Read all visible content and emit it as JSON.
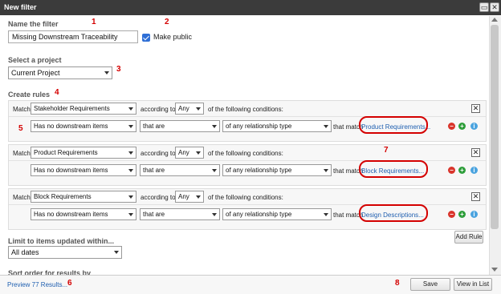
{
  "window": {
    "title": "New filter"
  },
  "filter_name": {
    "label": "Name the filter",
    "value": "Missing Downstream Traceability",
    "make_public_label": "Make public",
    "make_public": true
  },
  "project": {
    "label": "Select a project",
    "value": "Current Project"
  },
  "rules": {
    "label": "Create rules",
    "items": [
      {
        "match": "Match",
        "type": "Stakeholder Requirements",
        "according": "according to",
        "mode": "Any",
        "following": "of the following conditions:",
        "condition": "Has no downstream items",
        "qualifier": "that are",
        "relationship": "of any relationship type",
        "that_match": "that match",
        "target": "Product Requirements..."
      },
      {
        "match": "Match",
        "type": "Product Requirements",
        "according": "according to",
        "mode": "Any",
        "following": "of the following conditions:",
        "condition": "Has no downstream items",
        "qualifier": "that are",
        "relationship": "of any relationship type",
        "that_match": "that match",
        "target": "Block Requirements..."
      },
      {
        "match": "Match",
        "type": "Block Requirements",
        "according": "according to",
        "mode": "Any",
        "following": "of the following conditions:",
        "condition": "Has no downstream items",
        "qualifier": "that are",
        "relationship": "of any relationship type",
        "that_match": "that match",
        "target": "Design Descriptions..."
      }
    ],
    "add_rule_label": "Add Rule"
  },
  "limit": {
    "label": "Limit to items updated within...",
    "value": "All dates"
  },
  "sort": {
    "label": "Sort order for results by"
  },
  "footer": {
    "preview_label": "Preview 77 Results...",
    "save_label": "Save",
    "view_list_label": "View in List"
  },
  "annotations": [
    "1",
    "2",
    "3",
    "4",
    "5",
    "6",
    "7",
    "8"
  ],
  "icons": {
    "remove": "minus-icon",
    "add": "plus-icon",
    "info": "info-icon",
    "close": "close-icon"
  },
  "colors": {
    "titlebar": "#3b3b3b",
    "link": "#1f5fb0",
    "annotation": "#d40000",
    "checkbox": "#2f6fd6",
    "remove": "#d9342b",
    "add": "#2e9e3a",
    "info": "#4aa3df"
  }
}
